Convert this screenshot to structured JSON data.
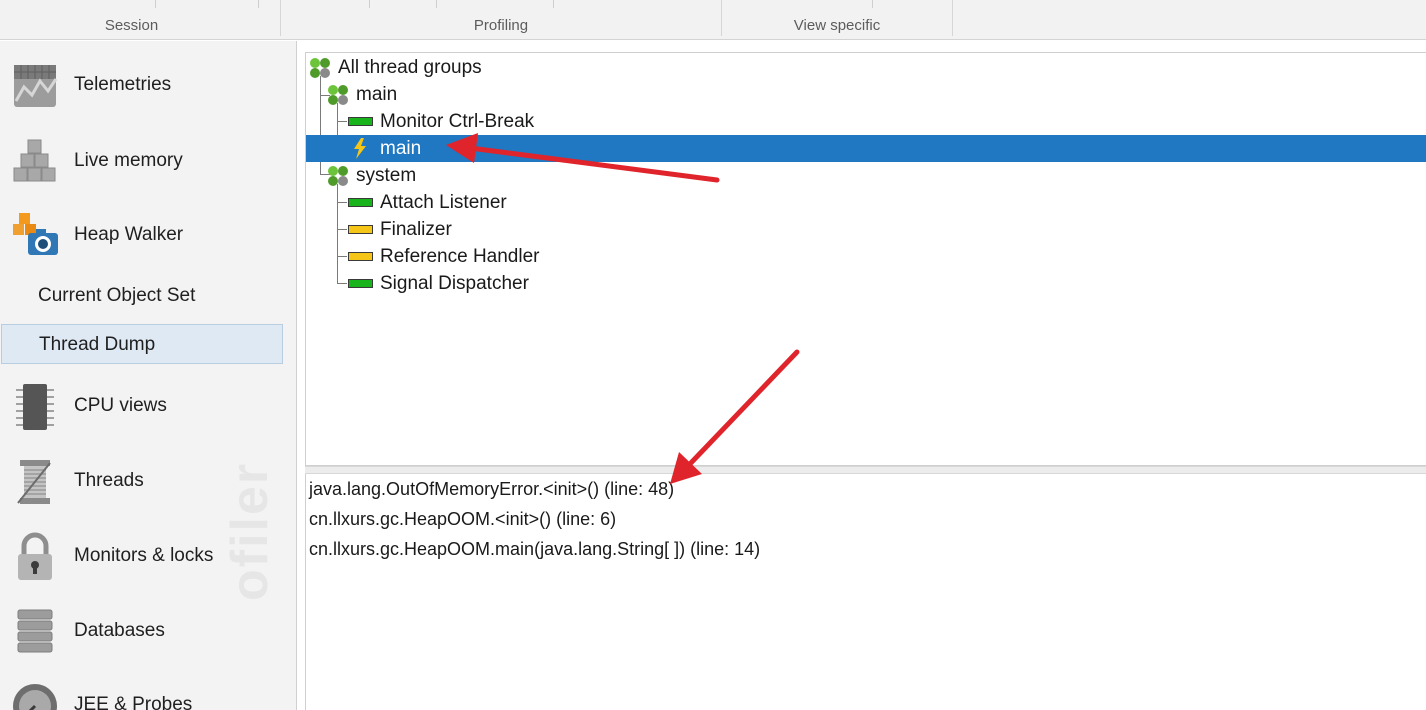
{
  "toolbar": {
    "groups": [
      {
        "label": "Session"
      },
      {
        "label": "Profiling"
      },
      {
        "label": "View specific"
      }
    ]
  },
  "sidebar": {
    "items": [
      {
        "label": "Telemetries",
        "icon": "telemetries-icon"
      },
      {
        "label": "Live memory",
        "icon": "live-memory-icon"
      },
      {
        "label": "Heap Walker",
        "icon": "heap-walker-icon"
      },
      {
        "label": "CPU views",
        "icon": "cpu-views-icon"
      },
      {
        "label": "Threads",
        "icon": "threads-icon"
      },
      {
        "label": "Monitors & locks",
        "icon": "monitors-locks-icon"
      },
      {
        "label": "Databases",
        "icon": "databases-icon"
      },
      {
        "label": "JEE & Probes",
        "icon": "jee-probes-icon"
      }
    ],
    "subitems": [
      {
        "label": "Current Object Set",
        "selected": false
      },
      {
        "label": "Thread Dump",
        "selected": true
      }
    ],
    "watermark": "ofiler"
  },
  "tree": {
    "root": {
      "label": "All thread groups",
      "icon": "thread-group-icon"
    },
    "groups": [
      {
        "label": "main",
        "icon": "thread-group-icon",
        "threads": [
          {
            "label": "Monitor Ctrl-Break",
            "state": "runnable",
            "color": "#19b31b"
          },
          {
            "label": "main",
            "state": "running",
            "color": "#f5c518",
            "selected": true
          }
        ]
      },
      {
        "label": "system",
        "icon": "thread-group-icon",
        "threads": [
          {
            "label": "Attach Listener",
            "state": "runnable",
            "color": "#19b31b"
          },
          {
            "label": "Finalizer",
            "state": "waiting",
            "color": "#f5c518"
          },
          {
            "label": "Reference Handler",
            "state": "waiting",
            "color": "#f5c518"
          },
          {
            "label": "Signal Dispatcher",
            "state": "runnable",
            "color": "#19b31b"
          }
        ]
      }
    ]
  },
  "stack": {
    "frames": [
      "java.lang.OutOfMemoryError.<init>() (line: 48)",
      "cn.llxurs.gc.HeapOOM.<init>() (line: 6)",
      "cn.llxurs.gc.HeapOOM.main(java.lang.String[ ]) (line: 14)"
    ]
  },
  "colors": {
    "selection": "#1f78c1",
    "annotation_arrow": "#e0242b",
    "runnable": "#19b31b",
    "waiting": "#f5c518"
  }
}
